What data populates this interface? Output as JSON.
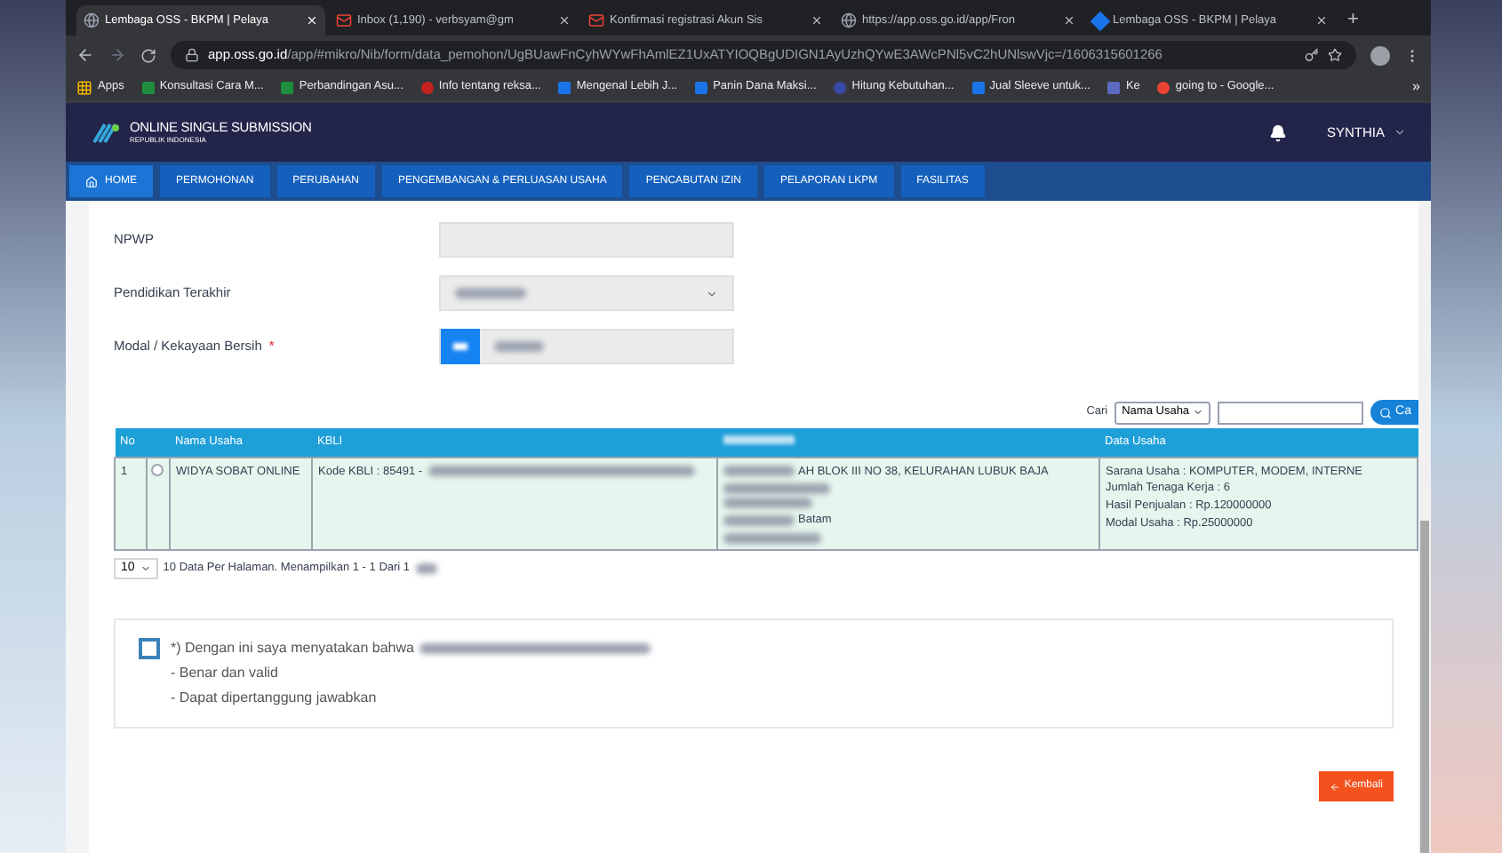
{
  "browser": {
    "tabs": [
      {
        "title": "Lembaga OSS - BKPM | Pelaya",
        "selected": true
      },
      {
        "title": "Inbox (1,190) - verbsyam@gm",
        "selected": false
      },
      {
        "title": "Konfirmasi registrasi Akun Sis",
        "selected": false
      },
      {
        "title": "https://app.oss.go.id/app/Fron",
        "selected": false
      },
      {
        "title": "Lembaga OSS - BKPM | Pelaya",
        "selected": false
      }
    ],
    "new_tab": "+",
    "address": {
      "host": "app.oss.go.id",
      "path": "/app/#mikro/Nib/form/data_pemohon/UgBUawFnCyhWYwFhAmlEZ1UxATYIOQBgUDIGN1AyUzhQYwE3AWcPNl5vC2hUNlswVjc=/1606315601266"
    },
    "bookmarks": [
      {
        "label": "Apps"
      },
      {
        "label": "Konsultasi Cara M...",
        "color": "#1e8e3e"
      },
      {
        "label": "Perbandingan Asu...",
        "color": "#1e8e3e"
      },
      {
        "label": "Info tentang reksa...",
        "color": "#c5221f"
      },
      {
        "label": "Mengenal Lebih J...",
        "color": "#1a73e8"
      },
      {
        "label": "Panin Dana Maksi...",
        "color": "#1a73e8"
      },
      {
        "label": "Hitung Kebutuhan...",
        "color": "#3949ab"
      },
      {
        "label": "Jual Sleeve untuk...",
        "color": "#1a73e8"
      },
      {
        "label": "Ke",
        "color": "#5c6bc0"
      },
      {
        "label": "going to - Google...",
        "color": "#ea4335"
      }
    ],
    "bookmarks_more": "»"
  },
  "app": {
    "brand": {
      "title": "ONLINE SINGLE SUBMISSION",
      "subtitle": "REPUBLIK INDONESIA"
    },
    "user": "SYNTHIA",
    "nav": [
      {
        "label": "HOME",
        "selected": true
      },
      {
        "label": "PERMOHONAN",
        "selected": false
      },
      {
        "label": "PERUBAHAN",
        "selected": false
      },
      {
        "label": "PENGEMBANGAN & PERLUASAN USAHA",
        "selected": false
      },
      {
        "label": "PENCABUTAN IZIN",
        "selected": false
      },
      {
        "label": "PELAPORAN LKPM",
        "selected": false
      },
      {
        "label": "FASILITAS",
        "selected": false
      }
    ]
  },
  "form": {
    "fields": [
      {
        "label": "NPWP",
        "kind": "input"
      },
      {
        "label": "Pendidikan Terakhir",
        "kind": "select"
      },
      {
        "label": "Modal / Kekayaan Bersih",
        "kind": "prefixed",
        "marker": "*"
      }
    ]
  },
  "search": {
    "label": "Cari",
    "filter": "Nama Usaha",
    "button": "Ca"
  },
  "table": {
    "columns": [
      {
        "kind": "text",
        "label": "No"
      },
      {
        "kind": "radio"
      },
      {
        "kind": "text",
        "label": "Nama Usaha"
      },
      {
        "kind": "text",
        "label": "KBLI"
      },
      {
        "kind": "redacted"
      },
      {
        "kind": "text",
        "label": "Data Usaha"
      }
    ],
    "rows": [
      {
        "no": "1",
        "selected": false,
        "nama_usaha": "WIDYA SOBAT ONLINE",
        "kbli": "Kode KBLI : 85491 -",
        "column_5": [
          "AH BLOK III NO 38, KELURAHAN LUBUK BAJA",
          "Batam"
        ],
        "data_usaha": [
          "Sarana Usaha : KOMPUTER, MODEM, INTERNE",
          "Jumlah Tenaga Kerja : 6",
          "Hasil Penjualan : Rp.120000000",
          "Modal Usaha : Rp.25000000"
        ]
      }
    ]
  },
  "pagination": {
    "page_size": "10",
    "summary": "10 Data Per Halaman. Menampilkan 1 - 1 Dari 1"
  },
  "declaration": {
    "checked": false,
    "lines": [
      "*) Dengan ini saya menyatakan bahwa",
      "- Benar dan valid",
      "- Dapat dipertanggung jawabkan"
    ]
  },
  "back_button": "Kembali"
}
